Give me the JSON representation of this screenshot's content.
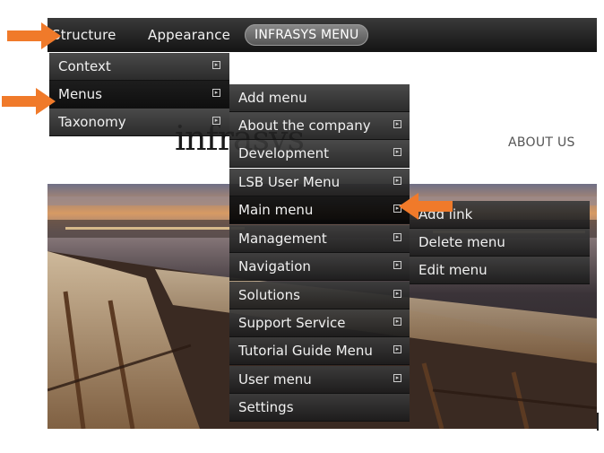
{
  "topbar": {
    "items": [
      "Structure",
      "Appearance"
    ],
    "active": "INFRASYS MENU"
  },
  "structure_menu": {
    "items": [
      {
        "label": "Context",
        "has_submenu": true
      },
      {
        "label": "Menus",
        "has_submenu": true
      },
      {
        "label": "Taxonomy",
        "has_submenu": true
      }
    ]
  },
  "menus_menu": {
    "items": [
      {
        "label": "Add menu",
        "has_submenu": false
      },
      {
        "label": "About the company",
        "has_submenu": true
      },
      {
        "label": "Development",
        "has_submenu": true
      },
      {
        "label": "LSB User Menu",
        "has_submenu": true
      },
      {
        "label": "Main menu",
        "has_submenu": true
      },
      {
        "label": "Management",
        "has_submenu": true
      },
      {
        "label": "Navigation",
        "has_submenu": true
      },
      {
        "label": "Solutions",
        "has_submenu": true
      },
      {
        "label": "Support Service",
        "has_submenu": true
      },
      {
        "label": "Tutorial Guide Menu",
        "has_submenu": true
      },
      {
        "label": "User menu",
        "has_submenu": true
      },
      {
        "label": "Settings",
        "has_submenu": false
      }
    ]
  },
  "main_menu_submenu": {
    "items": [
      {
        "label": "Add link"
      },
      {
        "label": "Delete menu"
      },
      {
        "label": "Edit menu"
      }
    ]
  },
  "page": {
    "logo": "infrasys",
    "about": "ABOUT US"
  },
  "colors": {
    "callout_arrow": "#f07a2a",
    "menu_bg": "#2a2a2a",
    "menu_text": "#f0f0f0"
  }
}
